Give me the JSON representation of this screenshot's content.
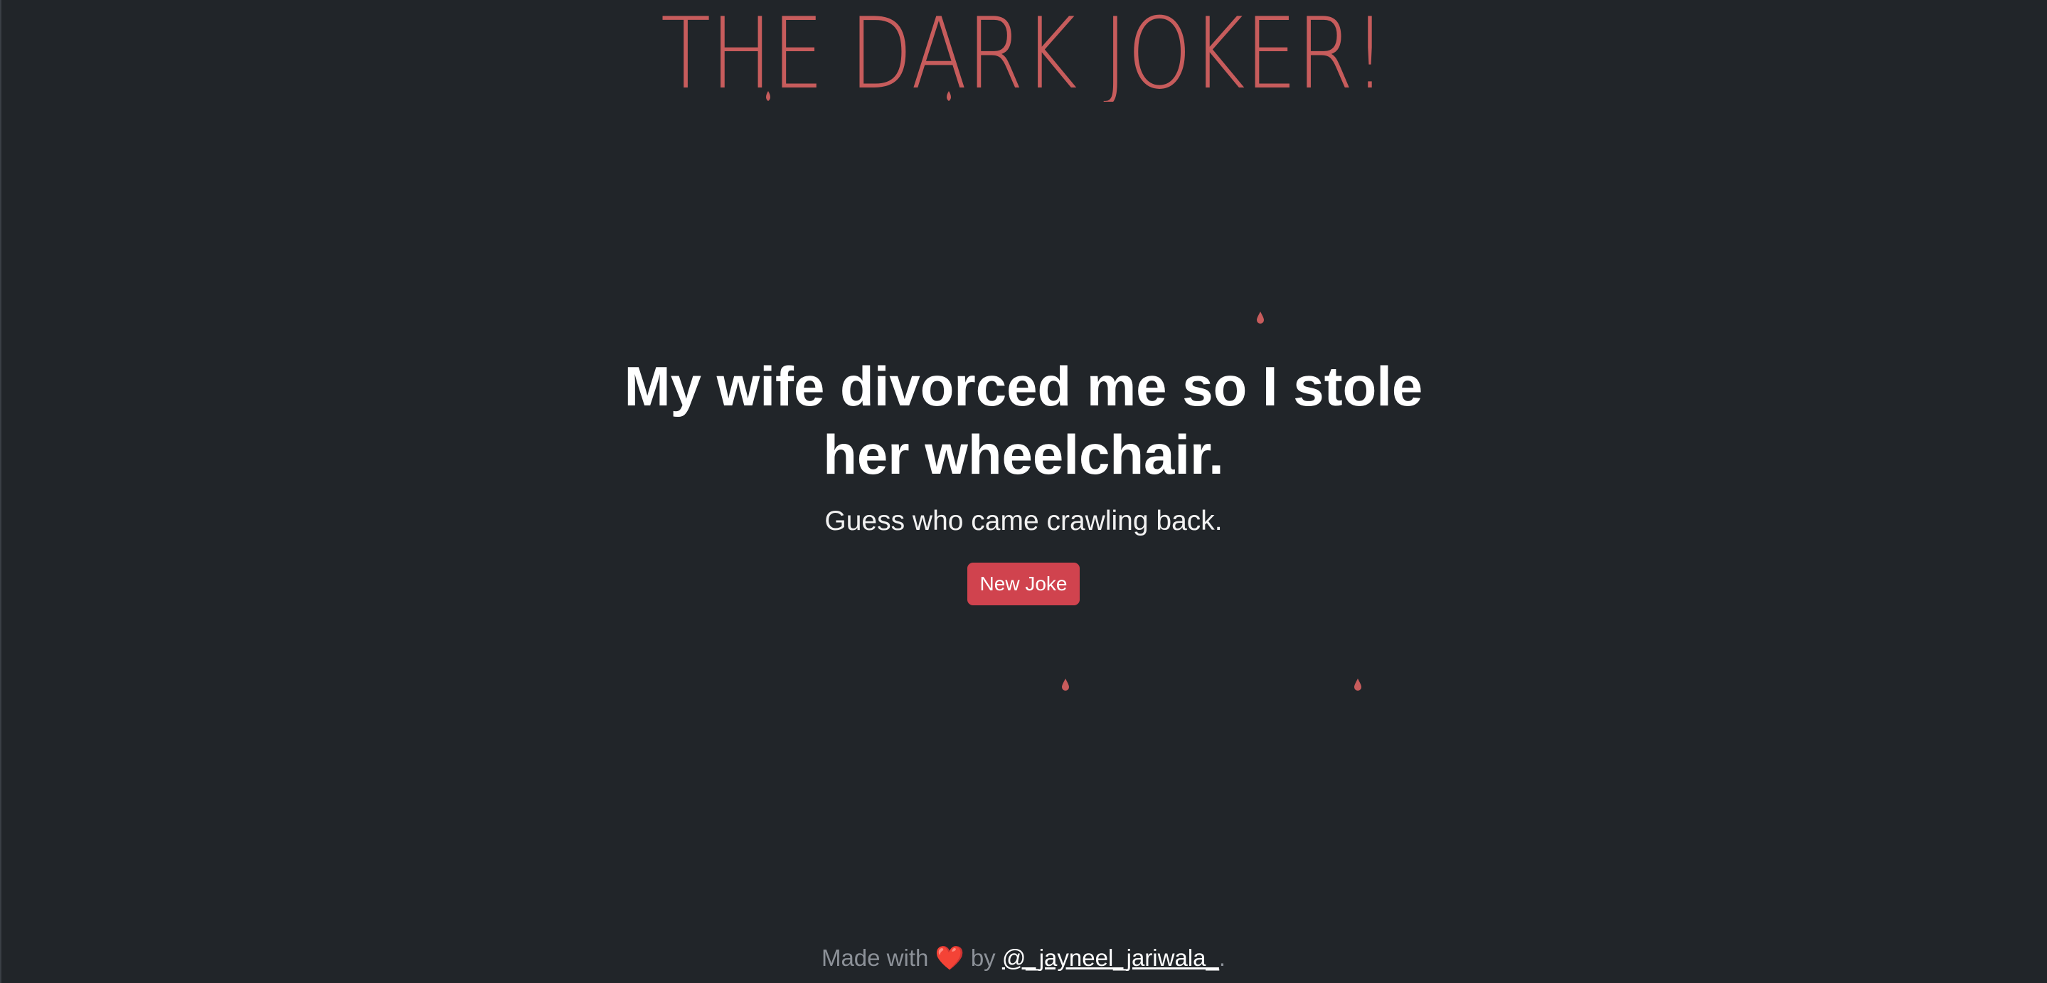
{
  "header": {
    "logo_text": "THE DARK JOKER!"
  },
  "joke": {
    "setup": "My wife divorced me so I stole her wheelchair.",
    "punchline": "Guess who came crawling back.",
    "button_label": "New Joke"
  },
  "footer": {
    "prefix": "Made with",
    "heart": "❤️",
    "by": "by",
    "author_link": "@_jayneel_jariwala_",
    "suffix": "."
  },
  "colors": {
    "background": "#212529",
    "logo": "#c75c5c",
    "button": "#d0434e",
    "drop": "#c75c5c"
  }
}
